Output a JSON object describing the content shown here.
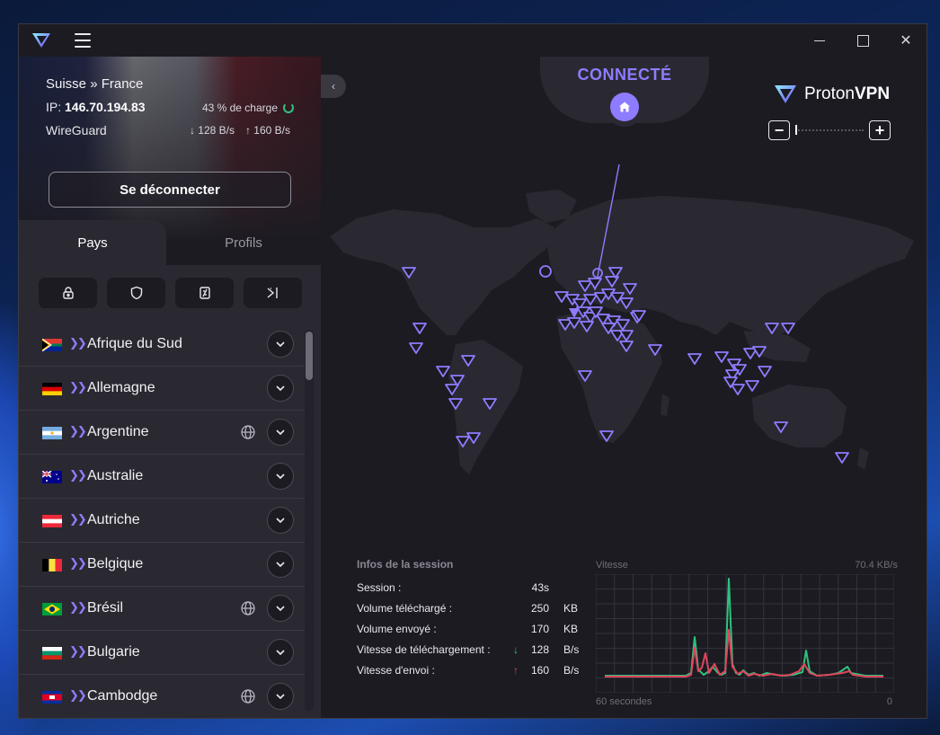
{
  "window": {
    "icons": {
      "logo": "protonvpn-logo-icon",
      "menu": "hamburger-menu-icon"
    }
  },
  "connection": {
    "route": "Suisse » France",
    "ip_label": "IP:",
    "ip_value": "146.70.194.83",
    "load": "43 % de charge",
    "protocol": "WireGuard",
    "download_speed": "↓ 128 B/s",
    "upload_speed": "↑ 160 B/s",
    "disconnect_label": "Se déconnecter"
  },
  "tabs": {
    "countries": "Pays",
    "profiles": "Profils"
  },
  "filters": [
    {
      "name": "secure-core-filter",
      "icon": "lock-icon"
    },
    {
      "name": "netshield-filter",
      "icon": "shield-icon"
    },
    {
      "name": "p2p-filter",
      "icon": "p2p-icon"
    },
    {
      "name": "tor-filter",
      "icon": "split-arrow-icon"
    }
  ],
  "countries": [
    {
      "name": "Afrique du Sud",
      "flag": "za",
      "globe": false
    },
    {
      "name": "Allemagne",
      "flag": "de",
      "globe": false
    },
    {
      "name": "Argentine",
      "flag": "ar",
      "globe": true
    },
    {
      "name": "Australie",
      "flag": "au",
      "globe": false
    },
    {
      "name": "Autriche",
      "flag": "at",
      "globe": false
    },
    {
      "name": "Belgique",
      "flag": "be",
      "globe": false
    },
    {
      "name": "Brésil",
      "flag": "br",
      "globe": true
    },
    {
      "name": "Bulgarie",
      "flag": "bg",
      "globe": false
    },
    {
      "name": "Cambodge",
      "flag": "kh",
      "globe": true
    }
  ],
  "main": {
    "status": "CONNECTÉ",
    "brand_proton": "Proton",
    "brand_vpn": "VPN",
    "accent": "#8d7cff"
  },
  "session": {
    "header": "Infos de la session",
    "rows": [
      {
        "label": "Session :",
        "value": "43s",
        "unit": "",
        "arrow": ""
      },
      {
        "label": "Volume téléchargé :",
        "value": "250",
        "unit": "KB",
        "arrow": ""
      },
      {
        "label": "Volume envoyé :",
        "value": "170",
        "unit": "KB",
        "arrow": ""
      },
      {
        "label": "Vitesse de téléchargement :",
        "value": "128",
        "unit": "B/s",
        "arrow": "↓"
      },
      {
        "label": "Vitesse d'envoi :",
        "value": "160",
        "unit": "B/s",
        "arrow": "↑"
      }
    ]
  },
  "speed_graph": {
    "label": "Vitesse",
    "max_label": "70.4  KB/s",
    "x_left": "60 secondes",
    "x_right": "0",
    "download_color": "#2ec27e",
    "upload_color": "#e0455c",
    "download": [
      2,
      2,
      2,
      2,
      2,
      2,
      2,
      2,
      2,
      2,
      2,
      2,
      2,
      2,
      2,
      2,
      2,
      2,
      2,
      2,
      2,
      2,
      2,
      2,
      2,
      2,
      2,
      2,
      2,
      2,
      2,
      2,
      2,
      2,
      2,
      2,
      2,
      2,
      2,
      2,
      2,
      2,
      2,
      2,
      2,
      2,
      2,
      2,
      2,
      2,
      2,
      2,
      2,
      2,
      2,
      2,
      2,
      2,
      2,
      2,
      2,
      2,
      2,
      2,
      2,
      2,
      2,
      2,
      2,
      2,
      2,
      2,
      2,
      2,
      2,
      2,
      2,
      2,
      2,
      2,
      2,
      2,
      2,
      2,
      2,
      2,
      2,
      2,
      2,
      2,
      2,
      2,
      2,
      2,
      2,
      2,
      2,
      2,
      2,
      2,
      2,
      2,
      2,
      2,
      2,
      2,
      2,
      2,
      2,
      2,
      2,
      2,
      2,
      2,
      2,
      2,
      2,
      2,
      2,
      2,
      2,
      2,
      2,
      2,
      2,
      2,
      2,
      2,
      2,
      2,
      2,
      2,
      2,
      2,
      2,
      2,
      2,
      2,
      2,
      2,
      2,
      2,
      2,
      2,
      2,
      2,
      2,
      2,
      2,
      2
    ]
  }
}
